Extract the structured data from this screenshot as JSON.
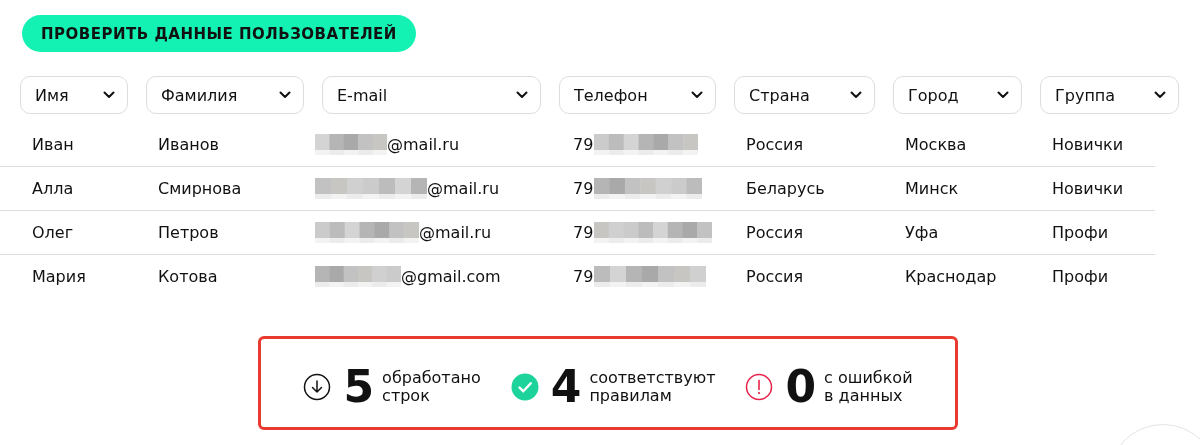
{
  "action_button": {
    "label": "ПРОВЕРИТЬ ДАННЫЕ ПОЛЬЗОВАТЕЛЕЙ"
  },
  "table": {
    "columns": [
      {
        "label": "Имя"
      },
      {
        "label": "Фамилия"
      },
      {
        "label": "E-mail"
      },
      {
        "label": "Телефон"
      },
      {
        "label": "Страна"
      },
      {
        "label": "Город"
      },
      {
        "label": "Группа"
      }
    ],
    "rows": [
      {
        "first_name": "Иван",
        "last_name": "Иванов",
        "email": "@mail.ru",
        "phone": "79",
        "country": "Россия",
        "city": "Москва",
        "group": "Новички"
      },
      {
        "first_name": "Алла",
        "last_name": "Смирнова",
        "email": "@mail.ru",
        "phone": "79",
        "country": "Беларусь",
        "city": "Минск",
        "group": "Новички"
      },
      {
        "first_name": "Олег",
        "last_name": "Петров",
        "email": "@mail.ru",
        "phone": "79",
        "country": "Россия",
        "city": "Уфа",
        "group": "Профи"
      },
      {
        "first_name": "Мария",
        "last_name": "Котова",
        "email": "@gmail.com",
        "phone": "79",
        "country": "Россия",
        "city": "Краснодар",
        "group": "Профи"
      }
    ]
  },
  "summary": [
    {
      "kind": "processed",
      "count": "5",
      "label": "обработано\nстрок"
    },
    {
      "kind": "valid",
      "count": "4",
      "label": "соответствуют\nправилам"
    },
    {
      "kind": "error",
      "count": "0",
      "label": "с ошибкой\nв данных"
    }
  ]
}
